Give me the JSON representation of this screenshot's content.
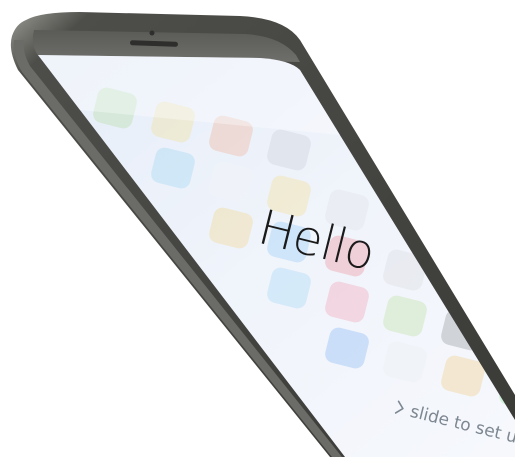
{
  "image": {
    "description_free": true,
    "background_color": "#ffffff"
  },
  "device": {
    "frame_color": "#4a4a47",
    "frame_highlight": "#8b8b86",
    "screen_color": "#eef3fb",
    "speaker_icon": "speaker-grille-icon",
    "camera_icon": "front-camera-icon"
  },
  "lock_screen": {
    "greeting": "Hello",
    "slide_prompt": "slide to set u",
    "slide_chevron_icon": "chevron-right-icon"
  },
  "blurred_app_icons": [
    {
      "color": "#8bd06a"
    },
    {
      "color": "#f6d55c"
    },
    {
      "color": "#f08a5d"
    },
    {
      "color": "#b8b8c0"
    },
    {
      "color": "#6fc3ef"
    },
    {
      "color": "#f5f5f5"
    },
    {
      "color": "#fbd34d"
    },
    {
      "color": "#d7d7dc"
    },
    {
      "color": "#f5c542"
    },
    {
      "color": "#5ab0f0"
    },
    {
      "color": "#e84d5b"
    },
    {
      "color": "#c9c9cf"
    },
    {
      "color": "#72c6f2"
    },
    {
      "color": "#f06a8a"
    },
    {
      "color": "#9ad36b"
    },
    {
      "color": "#555a61"
    },
    {
      "color": "#3f8ef0"
    },
    {
      "color": "#e8e8ec"
    },
    {
      "color": "#f3b33d"
    },
    {
      "color": "#4cd964"
    }
  ]
}
